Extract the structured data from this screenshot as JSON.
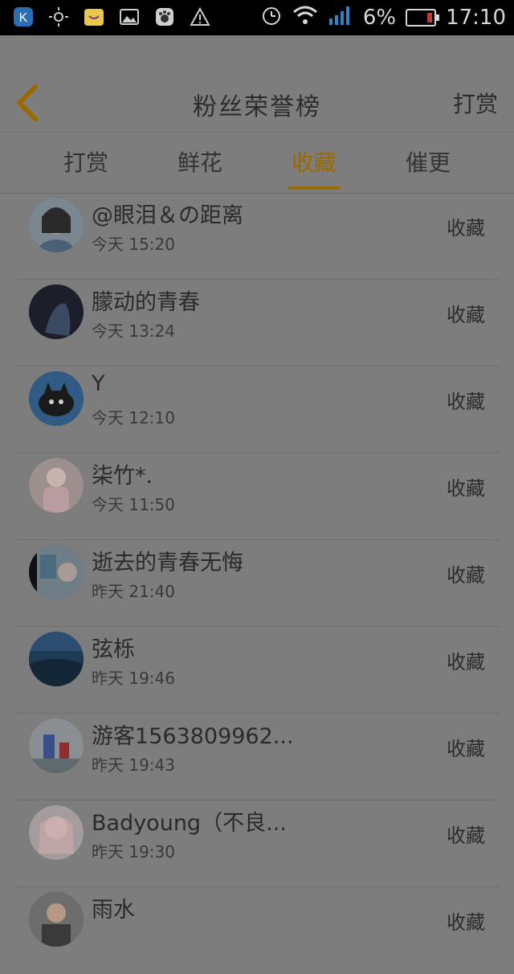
{
  "status_bar": {
    "battery": "6%",
    "time": "17:10",
    "icons": [
      "app-k-icon",
      "brightness-icon",
      "app-store-icon",
      "gallery-icon",
      "paw-app-icon",
      "warning-icon",
      "alarm-icon",
      "wifi-icon",
      "signal-icon",
      "battery-icon"
    ]
  },
  "header": {
    "title": "粉丝荣誉榜",
    "right_action": "打赏",
    "back_icon": "back-chevron-icon"
  },
  "tabs": [
    {
      "label": "打赏"
    },
    {
      "label": "鲜花"
    },
    {
      "label": "收藏",
      "active": true
    },
    {
      "label": "催更"
    }
  ],
  "list": [
    {
      "name": "@眼泪＆の距离",
      "time": "今天 15:20",
      "action": "收藏"
    },
    {
      "name": "朦动的青春",
      "time": "今天 13:24",
      "action": "收藏"
    },
    {
      "name": "Y",
      "time": "今天 12:10",
      "action": "收藏"
    },
    {
      "name": "柒竹*.",
      "time": "今天 11:50",
      "action": "收藏"
    },
    {
      "name": "逝去的青春无悔",
      "time": "昨天 21:40",
      "action": "收藏"
    },
    {
      "name": "弦栎",
      "time": "昨天 19:46",
      "action": "收藏"
    },
    {
      "name": "游客1563809962...",
      "time": "昨天 19:43",
      "action": "收藏"
    },
    {
      "name": "Badyoung（不良...",
      "time": "昨天 19:30",
      "action": "收藏"
    },
    {
      "name": "雨水",
      "time": "",
      "action": "收藏"
    }
  ],
  "colors": {
    "accent": "#9a6a00",
    "overlay_bg": "#7d7d7d",
    "text": "#2b2b2b"
  }
}
